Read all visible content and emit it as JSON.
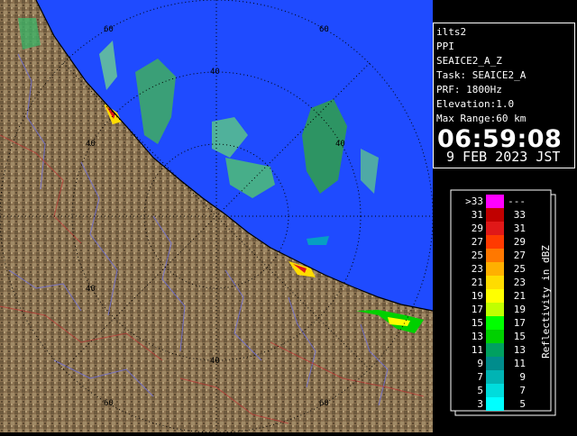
{
  "info": {
    "site": "ilts2",
    "mode": "PPI",
    "product": "SEAICE2_A_Z",
    "task": "Task: SEAICE2_A",
    "prf": "PRF: 1800Hz",
    "elevation": "Elevation:1.0",
    "max_range": "Max Range:60 km",
    "time": "06:59:08",
    "date": "9 FEB 2023 JST"
  },
  "range_labels": [
    "60",
    "60",
    "40",
    "40",
    "40",
    "40",
    "40",
    "60",
    "60"
  ],
  "legend": {
    "title": "Reflectivity in dBZ",
    "left_labels": [
      ">33",
      "31",
      "29",
      "27",
      "25",
      "23",
      "21",
      "19",
      "17",
      "15",
      "13",
      "11",
      "9",
      "7",
      "5",
      "3"
    ],
    "right_labels": [
      "---",
      "33",
      "31",
      "29",
      "27",
      "25",
      "23",
      "21",
      "19",
      "17",
      "15",
      "13",
      "11",
      "9",
      "7",
      "5"
    ],
    "colors": [
      "#ff00ff",
      "#c00000",
      "#e01818",
      "#ff3a00",
      "#ff7800",
      "#ffb000",
      "#ffdc00",
      "#ffff00",
      "#c0ff00",
      "#00ff00",
      "#00d000",
      "#00a060",
      "#008c8c",
      "#00b4b4",
      "#00dcdc",
      "#00ffff"
    ]
  }
}
